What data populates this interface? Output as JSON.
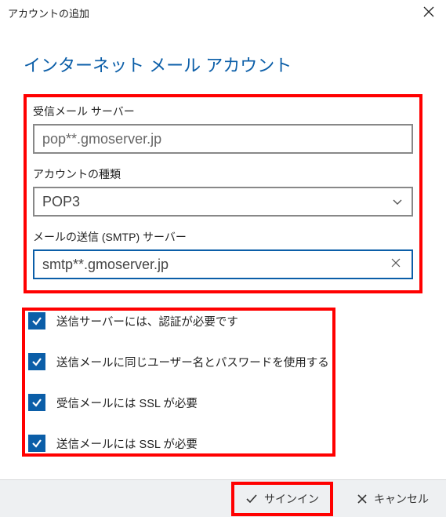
{
  "window": {
    "title": "アカウントの追加"
  },
  "page": {
    "heading": "インターネット メール アカウント"
  },
  "fields": {
    "incoming_label": "受信メール サーバー",
    "incoming_value": "pop**.gmoserver.jp",
    "account_type_label": "アカウントの種類",
    "account_type_value": "POP3",
    "smtp_label": "メールの送信 (SMTP) サーバー",
    "smtp_value": "smtp**.gmoserver.jp"
  },
  "checks": {
    "c1": "送信サーバーには、認証が必要です",
    "c2": "送信メールに同じユーザー名とパスワードを使用する",
    "c3": "受信メールには SSL が必要",
    "c4": "送信メールには SSL が必要"
  },
  "footer": {
    "signin": "サインイン",
    "cancel": "キャンセル"
  }
}
